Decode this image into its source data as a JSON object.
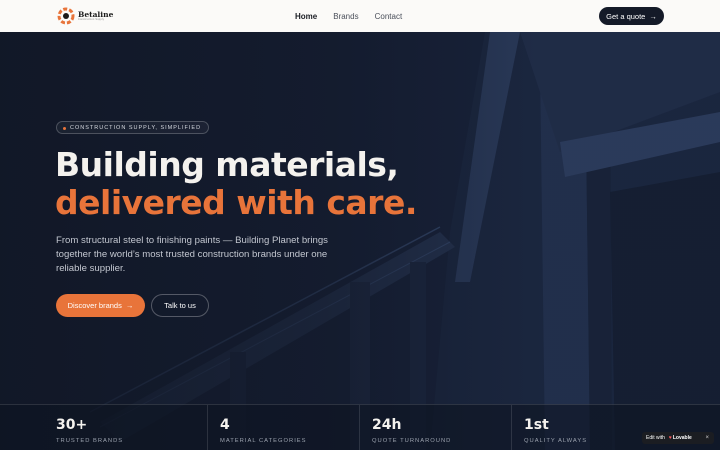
{
  "header": {
    "logo": {
      "name": "Betaline",
      "tagline": "Construction Supply"
    },
    "nav": [
      {
        "label": "Home",
        "active": true
      },
      {
        "label": "Brands",
        "active": false
      },
      {
        "label": "Contact",
        "active": false
      }
    ],
    "cta": {
      "label": "Get a quote",
      "arrow": "→"
    }
  },
  "hero": {
    "pill": "CONSTRUCTION SUPPLY, SIMPLIFIED",
    "title_line1": "Building materials,",
    "title_line2": "delivered with care.",
    "subtitle": "From structural steel to finishing paints — Building Planet brings together the world’s most trusted construction brands under one reliable supplier.",
    "primary_button": {
      "label": "Discover brands",
      "arrow": "→"
    },
    "secondary_button": {
      "label": "Talk to us"
    }
  },
  "stats": [
    {
      "value": "30+",
      "label": "TRUSTED BRANDS"
    },
    {
      "value": "4",
      "label": "MATERIAL CATEGORIES"
    },
    {
      "value": "24h",
      "label": "QUOTE TURNAROUND"
    },
    {
      "value": "1st",
      "label": "QUALITY ALWAYS"
    }
  ],
  "badge": {
    "prefix": "Edit with",
    "brand": "Lovable",
    "close": "×"
  },
  "colors": {
    "accent": "#e8743a",
    "dark": "#141a28",
    "header_bg": "#fbfaf8",
    "hero_bg": "#141c2e"
  },
  "icons": {
    "arrow": "arrow-right-icon",
    "logo": "gear-logo-icon",
    "pill_dot": "dot-icon",
    "badge_heart": "heart-icon",
    "badge_close": "close-icon"
  }
}
